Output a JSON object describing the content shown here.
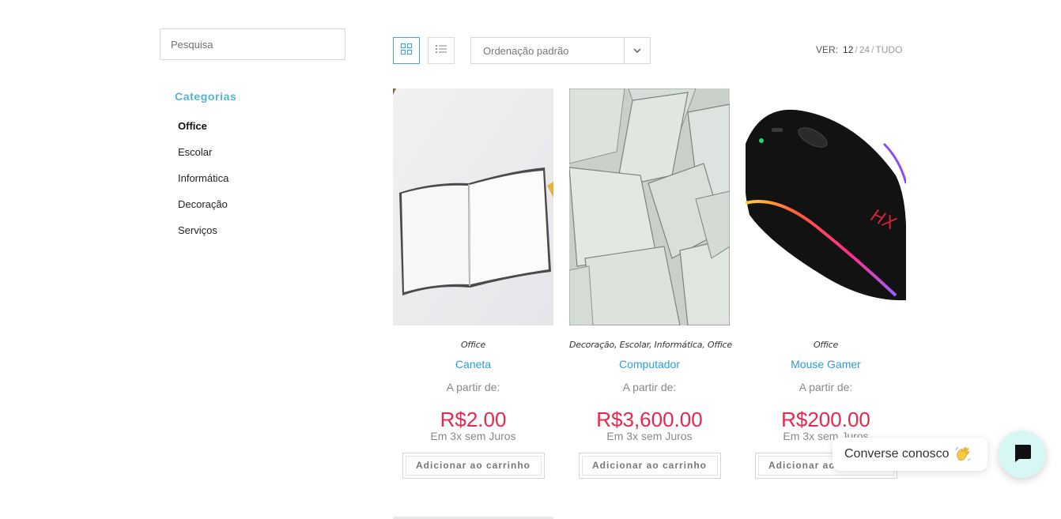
{
  "search": {
    "placeholder": "Pesquisa"
  },
  "sidebar": {
    "title": "Categorias",
    "categories": [
      {
        "label": "Office",
        "active": true
      },
      {
        "label": "Escolar"
      },
      {
        "label": "Informática"
      },
      {
        "label": "Decoração"
      },
      {
        "label": "Serviços"
      }
    ]
  },
  "toolbar": {
    "view_modes": [
      {
        "icon": "grid-view-icon",
        "active": true
      },
      {
        "icon": "list-view-icon",
        "active": false
      }
    ],
    "sort": {
      "selected": "Ordenação padrão",
      "icon": "chevron-down-icon"
    },
    "per_page": {
      "label": "VER:",
      "options": [
        "12",
        "24",
        "TUDO"
      ],
      "current": "12",
      "separator": "/"
    }
  },
  "products": [
    {
      "categories": "Office",
      "name": "Caneta",
      "price_prefix": "A partir de:",
      "price": "R$2.00",
      "installments": "Em 3x sem Juros",
      "button": "Adicionar ao carrinho",
      "image": "notebook-photo"
    },
    {
      "categories": "Decoração, Escolar, Informática, Office",
      "name": "Computador",
      "price_prefix": "A partir de:",
      "price": "R$3,600.00",
      "installments": "Em 3x sem Juros",
      "button": "Adicionar ao carrinho",
      "image": "paper-sheets-photo"
    },
    {
      "categories": "Office",
      "name": "Mouse Gamer",
      "price_prefix": "A partir de:",
      "price": "R$200.00",
      "installments": "Em 3x sem Juros",
      "button": "Adicionar ao carrinho",
      "image": "gaming-mouse-photo"
    }
  ],
  "chat": {
    "label": "Converse conosco",
    "emoji_icon": "waving-hand-icon",
    "launcher_icon": "chat-icon"
  },
  "colors": {
    "accent": "#55b3cf",
    "link": "#2e9dd4",
    "price": "#e6284d",
    "chat_launcher": "#d6f7f3"
  }
}
